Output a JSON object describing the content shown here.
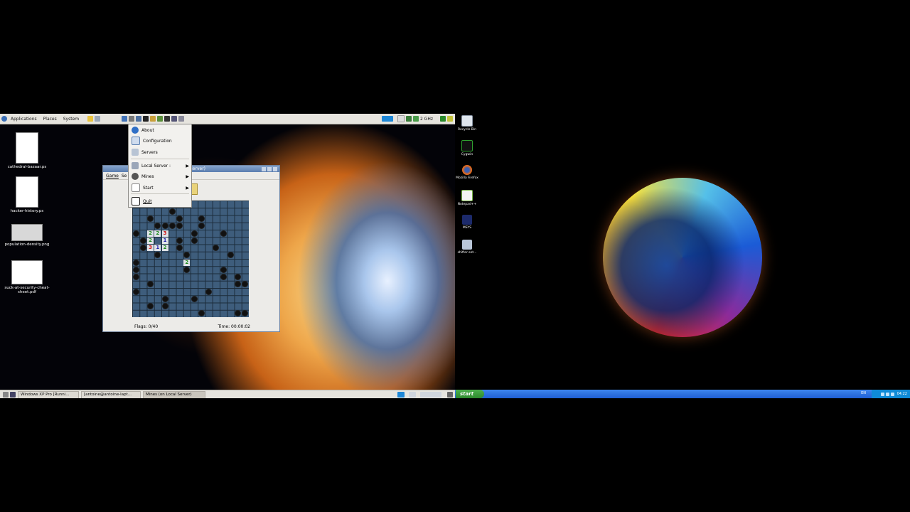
{
  "left": {
    "top_panel": {
      "menus": [
        "Applications",
        "Places",
        "System"
      ],
      "cpu_freq": "2 GHz"
    },
    "desktop_icons": [
      {
        "label": "cathedral-bazaar.ps"
      },
      {
        "label": "hacker-history.ps"
      },
      {
        "label": "population-density.png"
      },
      {
        "label": "suck-at-security-cheat-sheet.pdf"
      }
    ],
    "mines_window": {
      "title_fragment": "Server)",
      "menu": [
        "Game",
        "Se"
      ],
      "flags": "Flags: 0/40",
      "time": "Time: 00:00:02"
    },
    "popup_menu": {
      "items": [
        {
          "label": "About",
          "submenu": false
        },
        {
          "label": "Configuration",
          "submenu": false
        },
        {
          "label": "Servers",
          "submenu": false
        },
        {
          "label": "Local Server :",
          "submenu": true
        },
        {
          "label": "Mines",
          "submenu": true
        },
        {
          "label": "Start",
          "submenu": true
        },
        {
          "label": "Quit",
          "submenu": false
        }
      ]
    },
    "taskbar": {
      "tasks": [
        "Windows XP Pro [Runni...",
        "[antoine@antoine-lapt...",
        "Mines (on Local Server)"
      ]
    }
  },
  "right": {
    "desktop_icons": [
      {
        "label": "Recycle Bin"
      },
      {
        "label": "Cygwin"
      },
      {
        "label": "Mozilla Firefox"
      },
      {
        "label": "Notepad++"
      },
      {
        "label": "MSYS"
      },
      {
        "label": "shifter-set..."
      }
    ],
    "taskbar": {
      "start_label": "start",
      "lang": "EN",
      "clock": "04:22"
    }
  },
  "board": {
    "numbers": [
      {
        "r": 4,
        "c": 2,
        "v": "2",
        "color": "#1d8a1d"
      },
      {
        "r": 4,
        "c": 3,
        "v": "2",
        "color": "#1d8a1d"
      },
      {
        "r": 4,
        "c": 4,
        "v": "3",
        "color": "#d11010"
      },
      {
        "r": 5,
        "c": 2,
        "v": "2",
        "color": "#1d8a1d"
      },
      {
        "r": 5,
        "c": 4,
        "v": "1",
        "color": "#1a1aa8"
      },
      {
        "r": 6,
        "c": 2,
        "v": "3",
        "color": "#d11010"
      },
      {
        "r": 6,
        "c": 3,
        "v": "1",
        "color": "#1a1aa8"
      },
      {
        "r": 6,
        "c": 4,
        "v": "2",
        "color": "#1d8a1d"
      },
      {
        "r": 8,
        "c": 7,
        "v": "2",
        "color": "#1d8a1d"
      }
    ],
    "mines": [
      [
        1,
        5
      ],
      [
        2,
        2
      ],
      [
        2,
        6
      ],
      [
        3,
        3
      ],
      [
        3,
        4
      ],
      [
        3,
        5
      ],
      [
        3,
        6
      ],
      [
        3,
        9
      ],
      [
        4,
        0
      ],
      [
        4,
        8
      ],
      [
        4,
        12
      ],
      [
        5,
        1
      ],
      [
        5,
        6
      ],
      [
        5,
        8
      ],
      [
        6,
        1
      ],
      [
        6,
        11
      ],
      [
        7,
        3
      ],
      [
        7,
        7
      ],
      [
        7,
        13
      ],
      [
        9,
        0
      ],
      [
        9,
        7
      ],
      [
        9,
        12
      ],
      [
        10,
        0
      ],
      [
        10,
        12
      ],
      [
        10,
        14
      ],
      [
        11,
        14
      ],
      [
        11,
        15
      ],
      [
        12,
        0
      ],
      [
        12,
        10
      ],
      [
        13,
        4
      ],
      [
        14,
        2
      ],
      [
        14,
        4
      ],
      [
        15,
        9
      ],
      [
        15,
        14
      ],
      [
        15,
        15
      ],
      [
        2,
        9
      ],
      [
        6,
        6
      ],
      [
        8,
        0
      ],
      [
        11,
        2
      ],
      [
        13,
        8
      ]
    ]
  }
}
